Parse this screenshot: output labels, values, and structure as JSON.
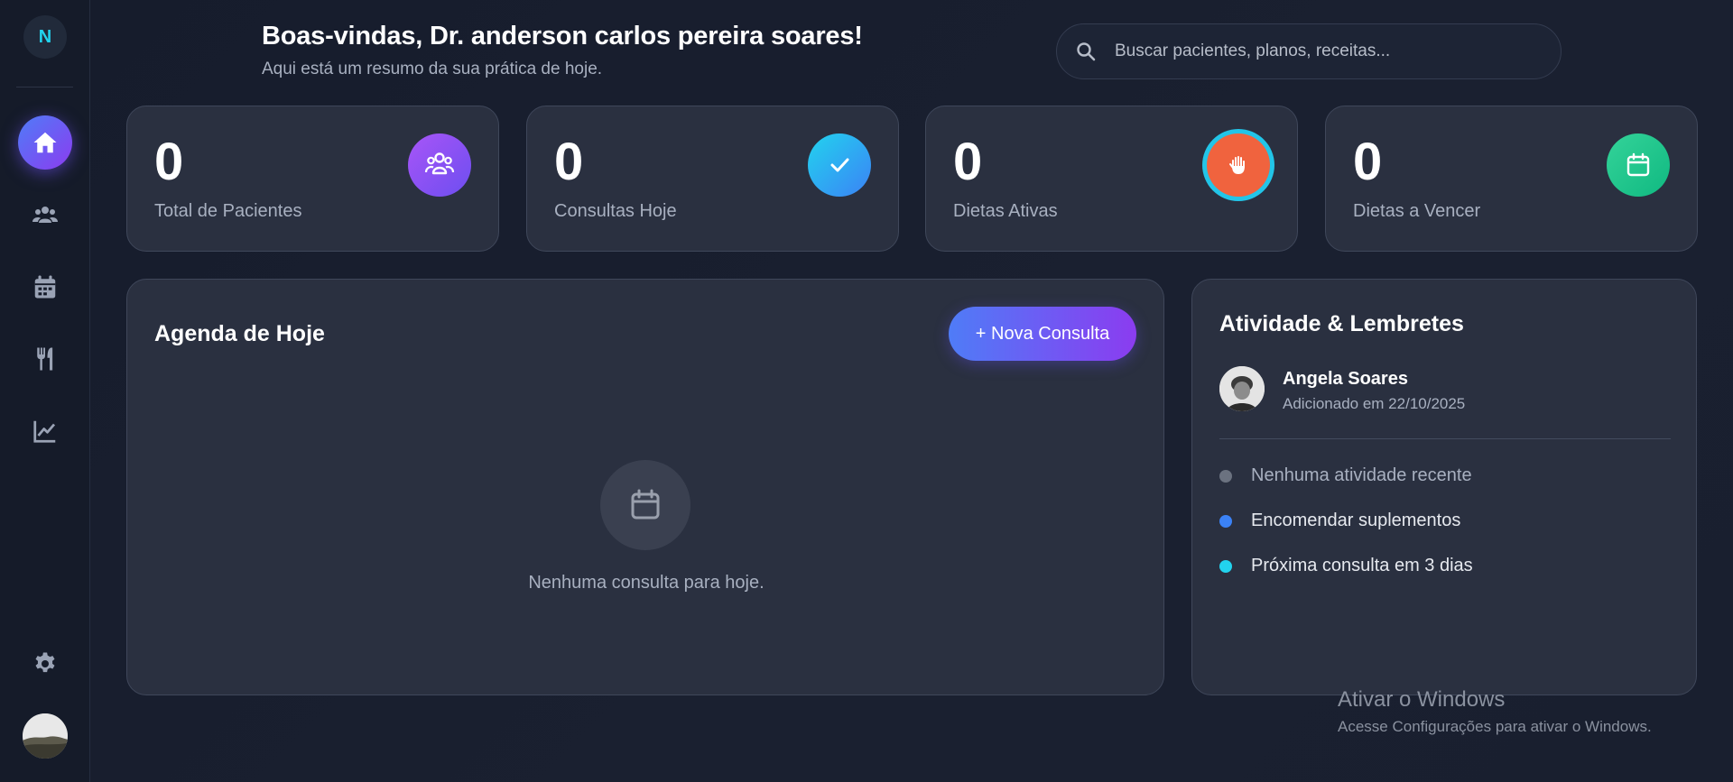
{
  "sidebar": {
    "logo_letter": "N",
    "items": [
      {
        "name": "home-icon",
        "active": true
      },
      {
        "name": "users-icon",
        "active": false
      },
      {
        "name": "calendar-icon",
        "active": false
      },
      {
        "name": "utensils-icon",
        "active": false
      },
      {
        "name": "chart-line-icon",
        "active": false
      }
    ],
    "settings_icon": "gear-icon",
    "avatar": "user-avatar"
  },
  "header": {
    "title": "Boas-vindas, Dr. anderson carlos pereira soares!",
    "subtitle": "Aqui está um resumo da sua prática de hoje.",
    "search_placeholder": "Buscar pacientes, planos, receitas..."
  },
  "stats": [
    {
      "value": "0",
      "label": "Total de Pacientes",
      "icon": "users-icon",
      "color": "#8b5cf6"
    },
    {
      "value": "0",
      "label": "Consultas Hoje",
      "icon": "check-icon",
      "color": "#38bdf8"
    },
    {
      "value": "0",
      "label": "Dietas Ativas",
      "icon": "hand-icon",
      "color": "#f0633e"
    },
    {
      "value": "0",
      "label": "Dietas a Vencer",
      "icon": "calendar-icon",
      "color": "#34d399"
    }
  ],
  "agenda": {
    "title": "Agenda de Hoje",
    "new_button": "+ Nova Consulta",
    "empty_text": "Nenhuma consulta para hoje."
  },
  "activity": {
    "title": "Atividade & Lembretes",
    "person": {
      "name": "Angela Soares",
      "subtitle": "Adicionado em 22/10/2025"
    },
    "reminders": [
      {
        "text": "Nenhuma atividade recente",
        "color": "#6b7280",
        "muted": true
      },
      {
        "text": "Encomendar suplementos",
        "color": "#3b82f6",
        "muted": false
      },
      {
        "text": "Próxima consulta em 3 dias",
        "color": "#22d3ee",
        "muted": false
      }
    ]
  },
  "watermark": {
    "title": "Ativar o Windows",
    "subtitle": "Acesse Configurações para ativar o Windows."
  },
  "colors": {
    "accent_start": "#4f7cf7",
    "accent_end": "#8b3cf0",
    "background": "#161c2c",
    "card": "#2a3040"
  }
}
